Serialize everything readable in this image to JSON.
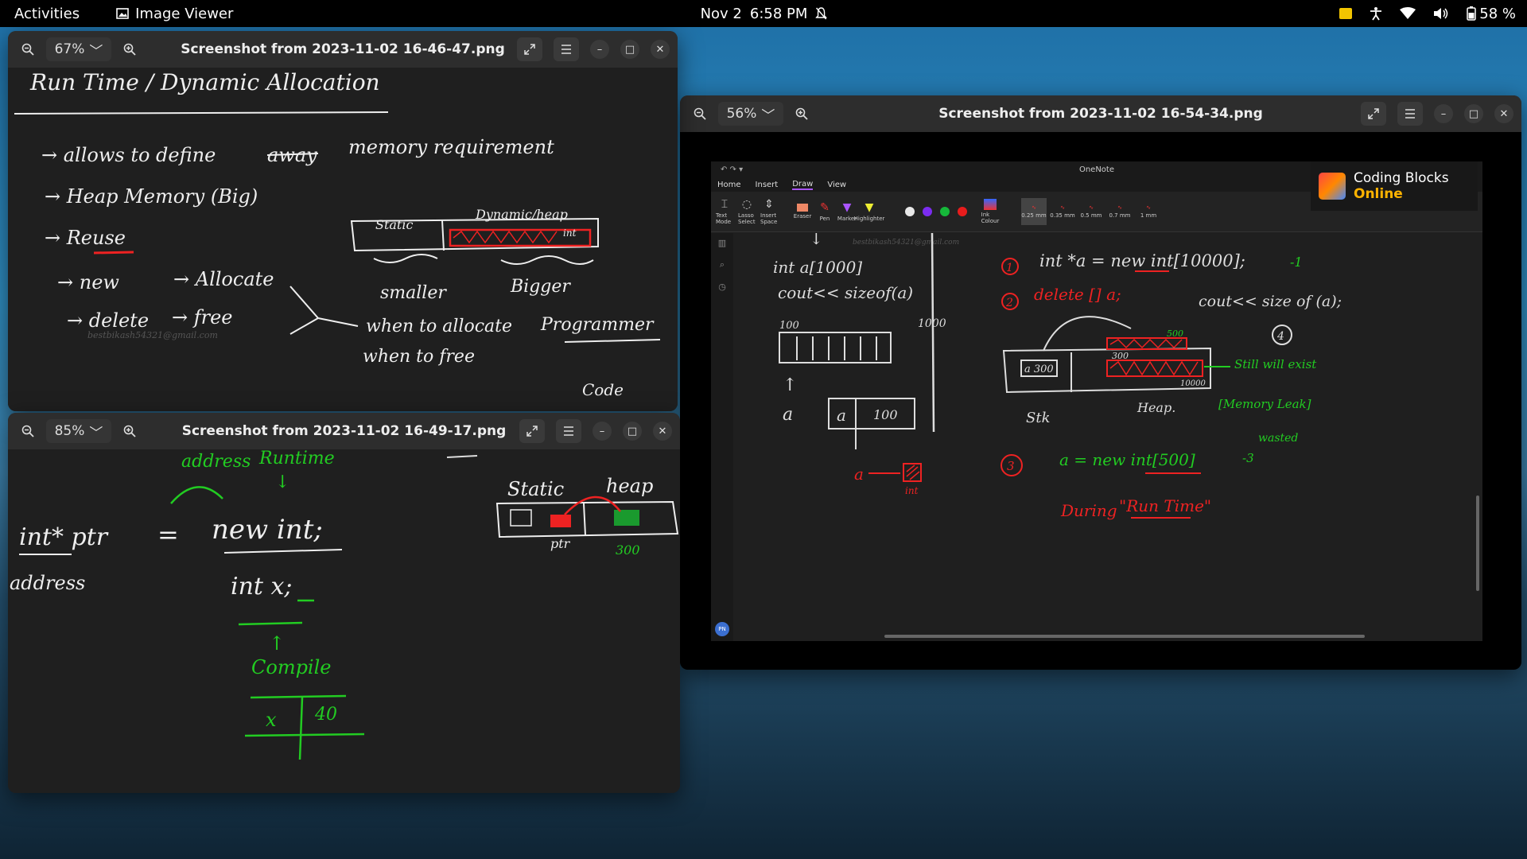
{
  "topbar": {
    "activities": "Activities",
    "app_name": "Image Viewer",
    "date": "Nov 2",
    "time": "6:58 PM",
    "battery": "58 %"
  },
  "win1": {
    "zoom": "67%",
    "title": "Screenshot from 2023-11-02 16-46-47.png",
    "notes": {
      "heading": "Run Time / Dynamic Allocation",
      "line1a": "→ allows to define",
      "line1b": "away",
      "line1c": "memory requirement",
      "line2": "→ Heap Memory (Big)",
      "line3": "→ Reuse",
      "line4a": "→ new",
      "line4b": "→ Allocate",
      "line5a": "→ delete",
      "line5b": "→ free",
      "box_static": "Static",
      "box_dynamic": "Dynamic/heap",
      "box_int": "int",
      "smaller": "smaller",
      "bigger": "Bigger",
      "when_alloc": "when to allocate",
      "when_free": "when to free",
      "programmer": "Programmer",
      "code": "Code",
      "watermark": "bestbikash54321@gmail.com"
    }
  },
  "win2": {
    "zoom": "85%",
    "title": "Screenshot from 2023-11-02 16-49-17.png",
    "notes": {
      "address_top": "address",
      "runtime": "Runtime",
      "intptr": "int* ptr",
      "equals": "=",
      "new_int": "new int;",
      "address": "address",
      "int_x": "int x;",
      "compile": "Compile",
      "x": "x",
      "val40": "40",
      "static": "Static",
      "heap": "heap",
      "ptr": "ptr",
      "val300": "300"
    }
  },
  "win3": {
    "zoom": "56%",
    "title": "Screenshot from 2023-11-02 16-54-34.png",
    "onenote": {
      "app_title": "OneNote",
      "tabs": [
        "Home",
        "Insert",
        "Draw",
        "View"
      ],
      "tools": [
        "Text Mode",
        "Lasso Select",
        "Insert Space",
        "Eraser",
        "Pen",
        "Marker",
        "Highlighter",
        "Ink Colour"
      ],
      "pen_sizes": [
        "0.25 mm",
        "0.35 mm",
        "0.5 mm",
        "0.7 mm",
        "1 mm"
      ],
      "colors": [
        "#e8e8e8",
        "#7b2cf0",
        "#16b83a",
        "#e81c1c"
      ],
      "badge_line1": "Coding Blocks",
      "badge_line2": "Online",
      "avatar": "PN",
      "watermark": "bestbikash54321@gmail.com",
      "notes": {
        "int_a": "int a[1000]",
        "cout": "cout<< sizeof(a)",
        "n100": "100",
        "n1000": "1000",
        "a": "a",
        "a_box": "a",
        "v100": "100",
        "s1": "1",
        "stmt1": "int *a = new int[10000];",
        "tag1": "-1",
        "s2": "2",
        "stmt2": "delete [] a;",
        "cout2": "cout<< size of (a);",
        "s4": "4",
        "val500": "500",
        "val300": "300",
        "a300": "a 300",
        "heap": "Heap.",
        "stack": "Stk",
        "still": "Still will exist",
        "memleak": "[Memory Leak]",
        "wasted": "wasted",
        "n10000": "10000",
        "a_arrow": "a",
        "int_label": "int",
        "s3": "3",
        "stmt3": "a = new int[500]",
        "tag3": "-3",
        "during": "During",
        "runtime": "\"Run Time\""
      }
    }
  }
}
